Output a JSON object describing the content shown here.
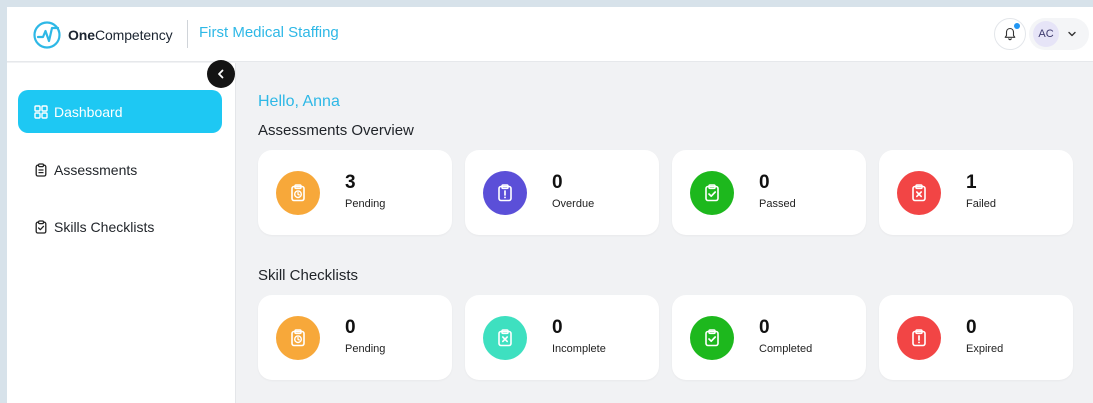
{
  "app": {
    "brand_bold": "One",
    "brand_rest": "Competency",
    "org_name": "First Medical Staffing"
  },
  "user": {
    "initials": "AC"
  },
  "sidebar": {
    "items": [
      {
        "label": "Dashboard",
        "icon": "dashboard-grid-icon",
        "active": true
      },
      {
        "label": "Assessments",
        "icon": "clipboard-icon",
        "active": false
      },
      {
        "label": "Skills Checklists",
        "icon": "clipboard-check-icon",
        "active": false
      }
    ]
  },
  "main": {
    "greeting": "Hello, Anna",
    "assessments_title": "Assessments Overview",
    "assessments": [
      {
        "value": "3",
        "label": "Pending",
        "color": "#f7a83a",
        "icon": "clipboard-clock-icon"
      },
      {
        "value": "0",
        "label": "Overdue",
        "color": "#5b4fd8",
        "icon": "clipboard-alert-icon"
      },
      {
        "value": "0",
        "label": "Passed",
        "color": "#1db81d",
        "icon": "clipboard-check-icon"
      },
      {
        "value": "1",
        "label": "Failed",
        "color": "#f24545",
        "icon": "clipboard-x-icon"
      }
    ],
    "skills_title": "Skill Checklists",
    "skills": [
      {
        "value": "0",
        "label": "Pending",
        "color": "#f7a83a",
        "icon": "clipboard-clock-icon"
      },
      {
        "value": "0",
        "label": "Incomplete",
        "color": "#3ee0c0",
        "icon": "clipboard-x-icon"
      },
      {
        "value": "0",
        "label": "Completed",
        "color": "#1db81d",
        "icon": "clipboard-check-icon"
      },
      {
        "value": "0",
        "label": "Expired",
        "color": "#f24545",
        "icon": "clipboard-alert-icon"
      }
    ]
  },
  "colors": {
    "accent": "#1ec8f3",
    "brand_text": "#2eb8e6"
  }
}
